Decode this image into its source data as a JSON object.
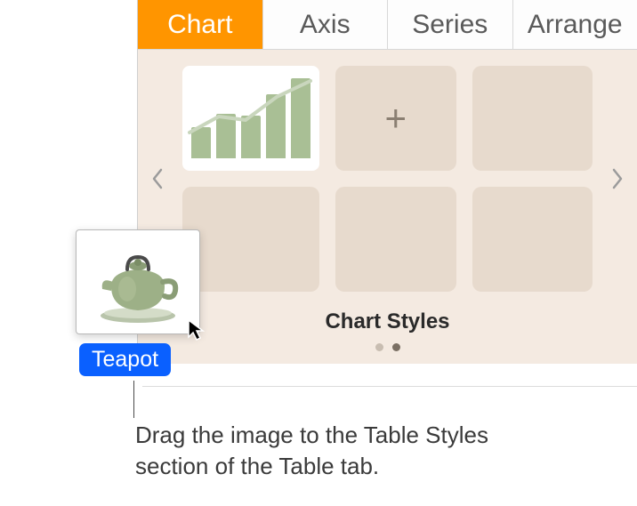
{
  "tabs": {
    "chart": "Chart",
    "axis": "Axis",
    "series": "Series",
    "arrange": "Arrange"
  },
  "styles": {
    "title": "Chart Styles"
  },
  "drag": {
    "label": "Teapot"
  },
  "callout": {
    "text": "Drag the image to the Table Styles section of the Table tab."
  }
}
